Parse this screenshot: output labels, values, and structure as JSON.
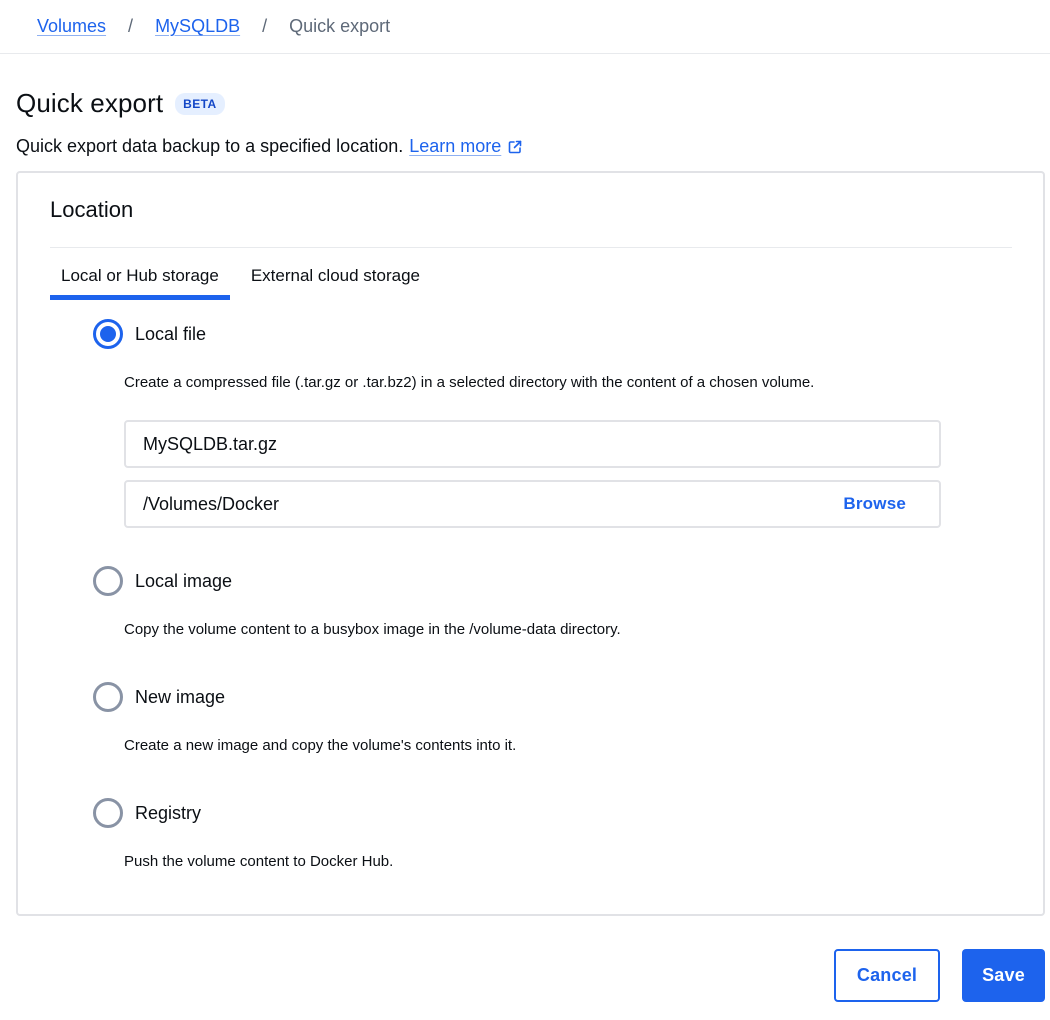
{
  "breadcrumb": {
    "items": [
      {
        "label": "Volumes",
        "link": true
      },
      {
        "label": "MySQLDB",
        "link": true
      },
      {
        "label": "Quick export",
        "link": false
      }
    ],
    "separator": "/"
  },
  "header": {
    "title": "Quick export",
    "badge": "BETA",
    "subtitle": "Quick export data backup to a specified location.",
    "learn_more": "Learn more",
    "learn_more_icon": "external-link-icon"
  },
  "location": {
    "title": "Location",
    "tabs": [
      {
        "label": "Local or Hub storage",
        "active": true
      },
      {
        "label": "External cloud storage",
        "active": false
      }
    ],
    "options": [
      {
        "label": "Local file",
        "selected": true,
        "description": "Create a compressed file (.tar.gz or .tar.bz2) in a selected directory with the content of a chosen volume."
      },
      {
        "label": "Local image",
        "selected": false,
        "description": "Copy the volume content to a busybox image in the /volume-data directory."
      },
      {
        "label": "New image",
        "selected": false,
        "description": "Create a new image and copy the volume's contents into it."
      },
      {
        "label": "Registry",
        "selected": false,
        "description": "Push the volume content to Docker Hub."
      }
    ],
    "file_name_value": "MySQLDB.tar.gz",
    "directory_value": "/Volumes/Docker",
    "browse_label": "Browse"
  },
  "actions": {
    "cancel_label": "Cancel",
    "save_label": "Save"
  },
  "colors": {
    "accent": "#1d63ed",
    "badge_bg": "#e5efff",
    "muted_text": "#5e6978",
    "border": "#e1e2e6"
  }
}
